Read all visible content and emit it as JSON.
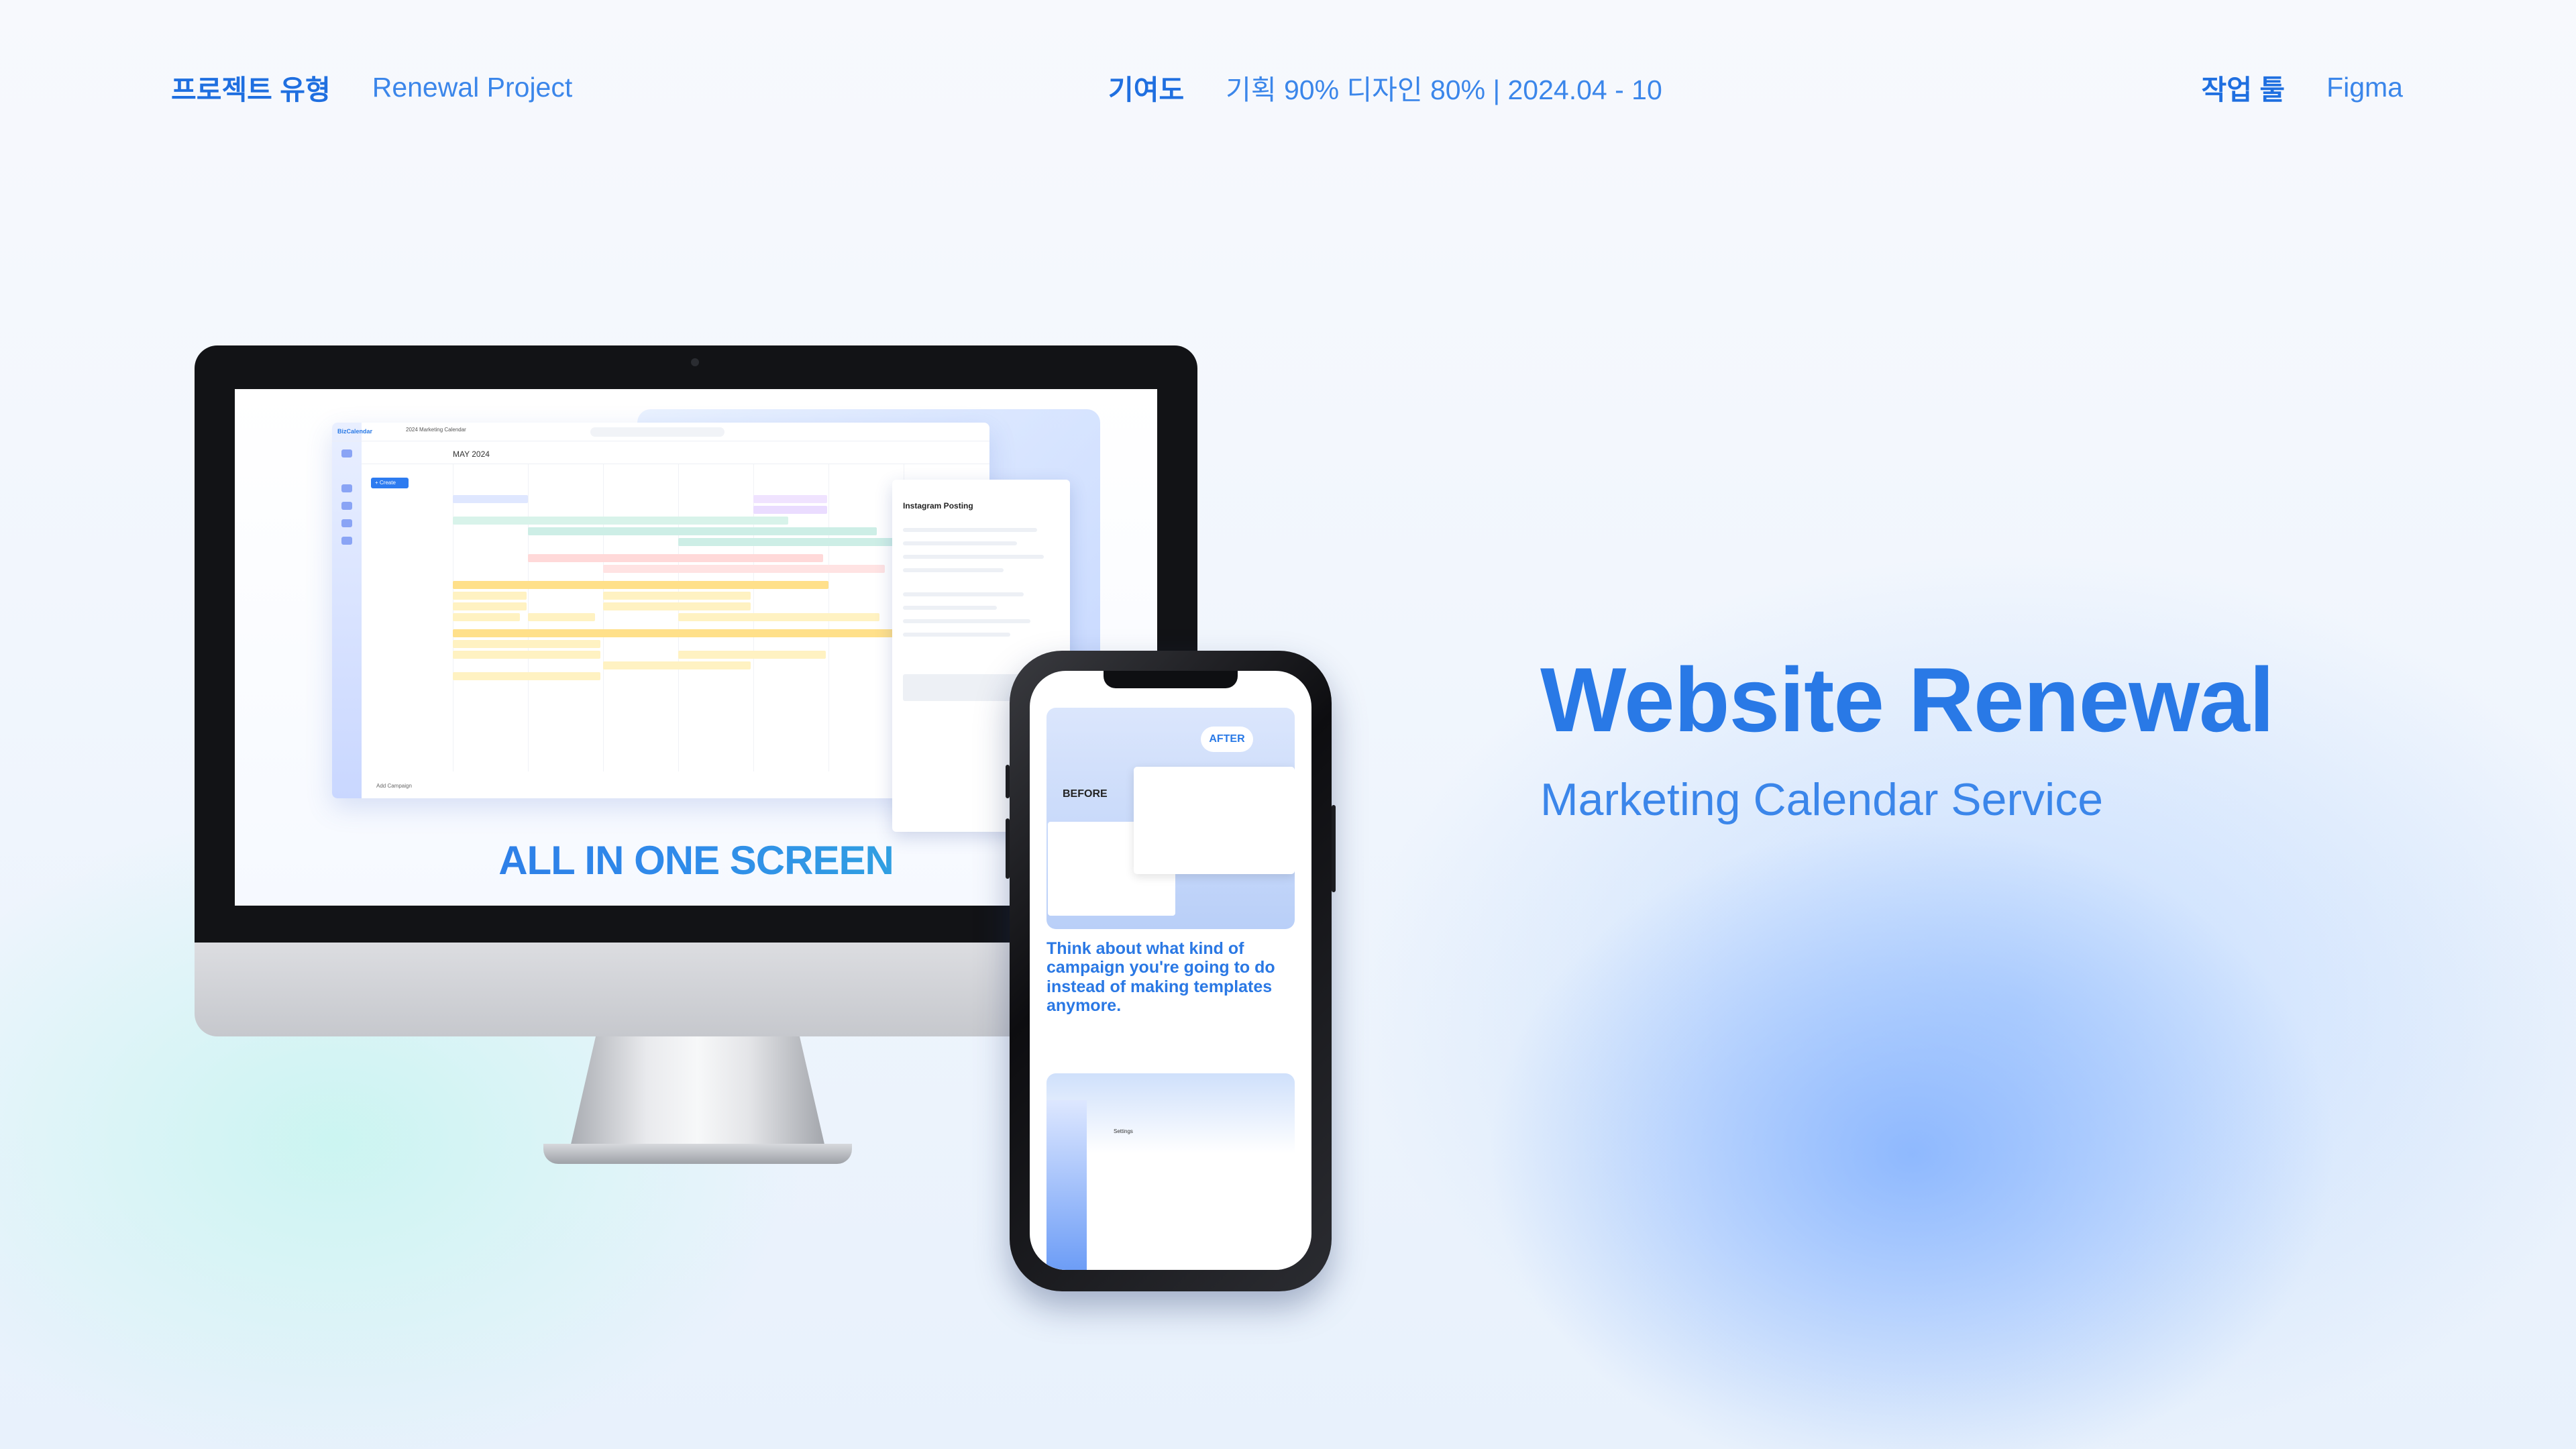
{
  "header": {
    "type_label": "프로젝트 유형",
    "type_value": "Renewal Project",
    "contribution_label": "기여도",
    "contribution_value": "기획 90% 디자인 80% | 2024.04 - 10",
    "tools_label": "작업 툴",
    "tools_value": "Figma"
  },
  "hero": {
    "title": "Website Renewal",
    "subtitle": "Marketing Calendar Service"
  },
  "desktop": {
    "tagline": "ALL IN ONE SCREEN",
    "app": {
      "brand": "BizCalendar",
      "page_title": "2024 Marketing Calendar",
      "month": "MAY 2024",
      "create_label": "+ Create",
      "add_campaign": "Add Campaign",
      "panel_title": "Instagram Posting"
    }
  },
  "mobile": {
    "after_label": "AFTER",
    "before_label": "BEFORE",
    "body_text": "Think about what kind of campaign you're going to do instead of making templates anymore.",
    "settings_label": "Settings"
  },
  "colors": {
    "accent": "#2979e6",
    "accent_light": "#3b86ea",
    "tagline_end": "#33b9d6"
  }
}
